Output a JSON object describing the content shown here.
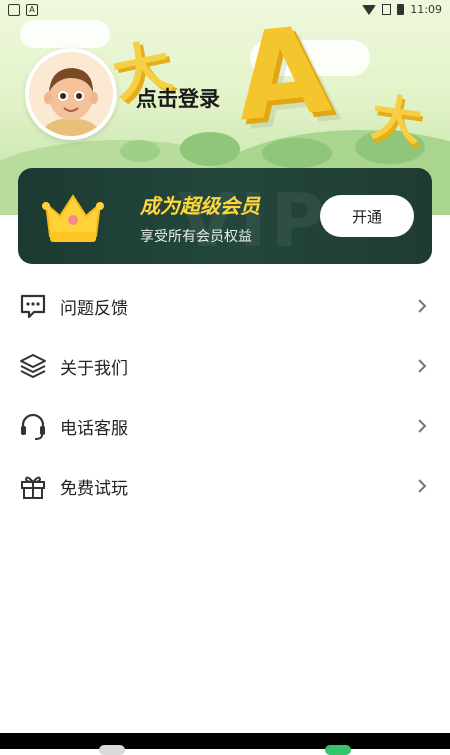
{
  "status_bar": {
    "time": "11:09"
  },
  "header": {
    "login_text": "点击登录",
    "deco_letter": "A",
    "deco_glyph_big": "大",
    "deco_glyph_small": "大"
  },
  "vip_card": {
    "title": "成为超级会员",
    "subtitle": "享受所有会员权益",
    "button": "开通",
    "watermark": "VIP"
  },
  "menu": [
    {
      "label": "问题反馈",
      "icon": "chat-feedback-icon"
    },
    {
      "label": "关于我们",
      "icon": "layers-icon"
    },
    {
      "label": "电话客服",
      "icon": "headset-icon"
    },
    {
      "label": "免费试玩",
      "icon": "gift-icon"
    }
  ],
  "colors": {
    "vip_bg": "#1f3b33",
    "vip_title": "#ffd73a",
    "accent_yellow": "#f4c62d"
  }
}
